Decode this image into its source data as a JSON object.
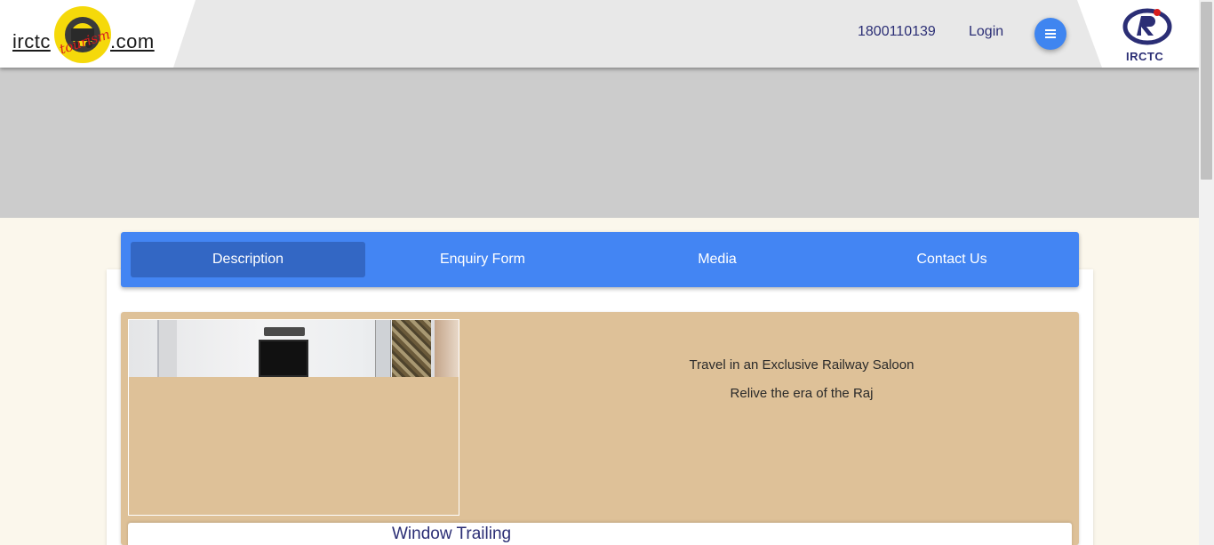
{
  "header": {
    "logo_left": "irctc",
    "logo_right": ".com",
    "logo_script": "tourism",
    "helpline": "1800110139",
    "login_label": "Login",
    "menu_icon": "hamburger-icon",
    "brand_text": "IRCTC"
  },
  "colors": {
    "header_bg": "#e8e8e8",
    "banner_bg": "#cccccc",
    "page_bg": "#fbf7ec",
    "tab_bar": "#4385f3",
    "tab_active": "#3367c4",
    "panel_bg": "#dec198",
    "navy": "#2b2e75"
  },
  "tabs": [
    {
      "label": "Description",
      "active": true
    },
    {
      "label": "Enquiry Form",
      "active": false
    },
    {
      "label": "Media",
      "active": false
    },
    {
      "label": "Contact Us",
      "active": false
    }
  ],
  "content": {
    "tagline_1": "Travel in an Exclusive Railway Saloon",
    "tagline_2": "Relive the era of the Raj",
    "section_title": "Window Trailing"
  }
}
